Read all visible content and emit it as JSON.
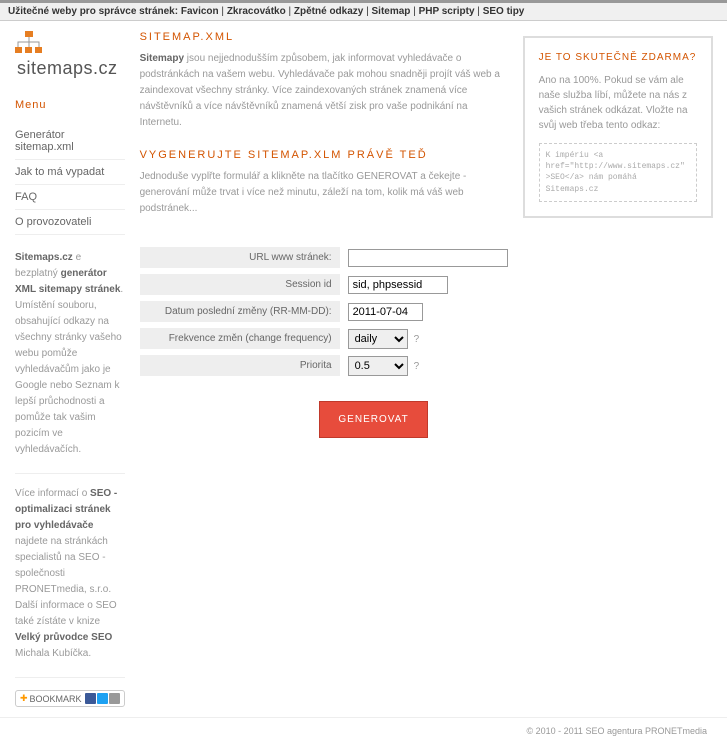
{
  "topbar": {
    "label": "Užitečné weby pro správce stránek:",
    "links": [
      "Favicon",
      "Zkracovátko",
      "Zpětné odkazy",
      "Sitemap",
      "PHP scripty",
      "SEO tipy"
    ]
  },
  "logo": {
    "text1": "sitemaps",
    "text2": ".cz"
  },
  "menu": {
    "title": "Menu",
    "items": [
      "Generátor sitemap.xml",
      "Jak to má vypadat",
      "FAQ",
      "O provozovateli"
    ]
  },
  "side1": {
    "html": "Sitemaps.cz e bezplatný generátor XML sitemapy stránek. Umístění souboru, obsahující odkazy na všechny stránky vašeho webu pomůže vyhledávačům jako je Google nebo Seznam k lepší průchodnosti a pomůže tak vašim pozicím ve vyhledávačích.",
    "b1": "Sitemaps.cz",
    "b2": "generátor XML sitemapy stránek"
  },
  "side2": {
    "text": "Více informací o SEO - optimalizaci stránek pro vyhledávače najdete na stránkách specialistů na SEO - společnosti PRONETmedia, s.r.o. Další informace o SEO také zístáte v knize Velký průvodce SEO Michala Kubíčka.",
    "b1": "SEO - optimalizaci stránek pro vyhledávače",
    "b2": "Velký průvodce SEO"
  },
  "bookmark": "BOOKMARK",
  "main": {
    "h1": "SITEMAP.XML",
    "p1b": "Sitemapy",
    "p1": " jsou nejjednodušším způsobem, jak informovat vyhledávače o podstránkách na vašem webu. Vyhledávače pak mohou snadněji projít váš web a zaindexovat všechny stránky. Více zaindexovaných stránek znamená více návštěvníků a více návštěvníků znamená větší zisk pro vaše podnikání na Internetu.",
    "h2": "VYGENERUJTE SITEMAP.XLM PRÁVĚ TEĎ",
    "p2": "Jednoduše vyplřte formulář a klikněte na tlačítko GENEROVAT a čekejte - generování může trvat i více než minutu, záleží na tom, kolik má váš web podstránek..."
  },
  "form": {
    "url_label": "URL www stránek:",
    "url_value": "",
    "session_label": "Session id",
    "session_value": "sid, phpsessid",
    "date_label": "Datum poslední změny (RR-MM-DD):",
    "date_value": "2011-07-04",
    "freq_label": "Frekvence změn (change frequency)",
    "freq_value": "daily",
    "prio_label": "Priorita",
    "prio_value": "0.5",
    "button": "GENEROVAT"
  },
  "rightbox": {
    "title": "JE TO SKUTEČNĚ ZDARMA?",
    "text": "Ano na 100%. Pokud se vám ale naše služba líbí, můžete na nás z vašich stránek odkázat. Vložte na svůj web třeba tento odkaz:",
    "code": "K impériu <a href=\"http://www.sitemaps.cz\">SEO</a> nám pomáhá Sitemaps.cz"
  },
  "footer": "© 2010 - 2011 SEO agentura PRONETmedia"
}
